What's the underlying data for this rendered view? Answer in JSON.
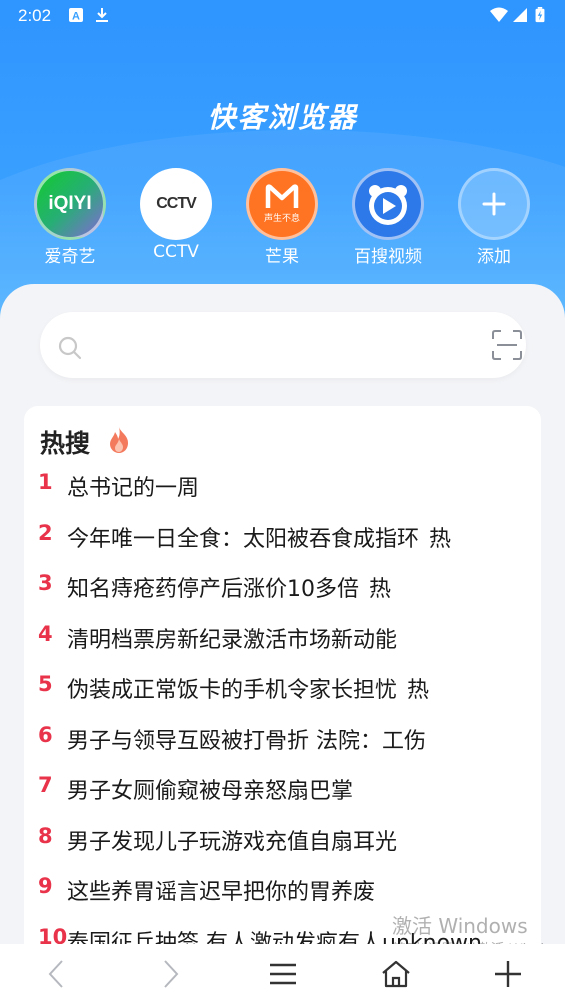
{
  "status_bar": {
    "time": "2:02",
    "icons": [
      "font-icon",
      "download-icon",
      "wifi-icon",
      "signal-icon",
      "battery-icon"
    ]
  },
  "app": {
    "title": "快客浏览器"
  },
  "shortcuts": [
    {
      "label": "爱奇艺",
      "icon": "iqiyi-logo",
      "logo_text": "iQIYI",
      "bg": "#00be06"
    },
    {
      "label": "CCTV",
      "icon": "cctv-logo",
      "logo_text": "CCTV",
      "bg": "#ffffff"
    },
    {
      "label": "芒果",
      "icon": "mango-logo",
      "logo_text": "声生不息",
      "bg": "#ff6a13"
    },
    {
      "label": "百搜视频",
      "icon": "baisou-video-logo",
      "bg": "#1e6fe8"
    },
    {
      "label": "添加",
      "icon": "plus-icon",
      "bg": "#5ab0ff"
    }
  ],
  "search": {
    "placeholder": "",
    "value": ""
  },
  "hot_search": {
    "title": "热搜",
    "items": [
      {
        "rank": "1",
        "text": "总书记的一周",
        "badge": ""
      },
      {
        "rank": "2",
        "text": "今年唯一日全食：太阳被吞食成指环",
        "badge": "热"
      },
      {
        "rank": "3",
        "text": "知名痔疮药停产后涨价10多倍",
        "badge": "热"
      },
      {
        "rank": "4",
        "text": "清明档票房新纪录激活市场新动能",
        "badge": ""
      },
      {
        "rank": "5",
        "text": "伪装成正常饭卡的手机令家长担忧",
        "badge": "热"
      },
      {
        "rank": "6",
        "text": "男子与领导互殴被打骨折 法院：工伤",
        "badge": ""
      },
      {
        "rank": "7",
        "text": "男子女厕偷窥被母亲怒扇巴掌",
        "badge": ""
      },
      {
        "rank": "8",
        "text": "男子发现儿子玩游戏充值自扇耳光",
        "badge": ""
      },
      {
        "rank": "9",
        "text": "这些养胃谣言迟早把你的胃养废",
        "badge": ""
      },
      {
        "rank": "10",
        "text": "泰国征兵抽签 有人激动发疯有人unknown",
        "badge": ""
      }
    ]
  },
  "watermark": {
    "line1": "激活 Windows",
    "line2": "转到“设置”以激活 Windows。"
  },
  "bottom_nav": [
    {
      "name": "back-button",
      "icon": "chevron-left-icon"
    },
    {
      "name": "forward-button",
      "icon": "chevron-right-icon"
    },
    {
      "name": "menu-button",
      "icon": "menu-icon"
    },
    {
      "name": "home-button",
      "icon": "home-icon"
    },
    {
      "name": "new-tab-button",
      "icon": "plus-icon"
    }
  ],
  "colors": {
    "header_blue": "#3aa0ff",
    "rank_red": "#e8334a",
    "panel_bg": "#f3f4f7"
  }
}
